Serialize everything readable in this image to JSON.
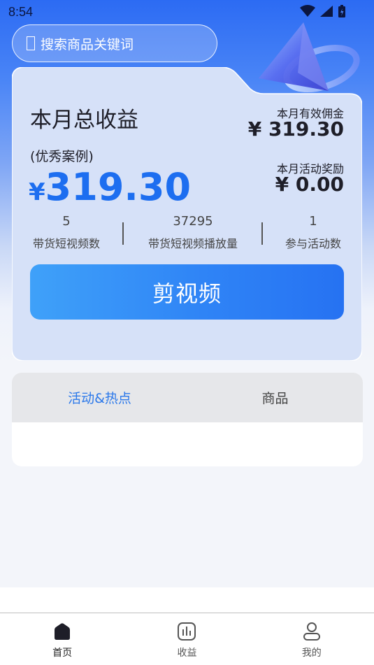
{
  "status_bar": {
    "time": "8:54"
  },
  "search": {
    "placeholder": "搜索商品关键词"
  },
  "summary": {
    "title": "本月总收益",
    "subtitle": "(优秀案例)",
    "currency": "¥",
    "total": "319.30",
    "commission_label": "本月有效佣金",
    "commission_value": "¥ 319.30",
    "reward_label": "本月活动奖励",
    "reward_value": "¥ 0.00"
  },
  "stats": [
    {
      "value": "5",
      "label": "带货短视频数"
    },
    {
      "value": "37295",
      "label": "带货短视频播放量"
    },
    {
      "value": "1",
      "label": "参与活动数"
    }
  ],
  "action": {
    "label": "剪视频"
  },
  "tabs": [
    {
      "label": "活动&热点",
      "active": true
    },
    {
      "label": "商品",
      "active": false
    }
  ],
  "bottom_nav": [
    {
      "label": "首页",
      "icon": "home-icon",
      "active": true
    },
    {
      "label": "收益",
      "icon": "chart-icon",
      "active": false
    },
    {
      "label": "我的",
      "icon": "user-icon",
      "active": false
    }
  ],
  "colors": {
    "accent": "#1d6ef0",
    "tab_active": "#2b78ea",
    "card_bg": "#d6e1f8"
  }
}
